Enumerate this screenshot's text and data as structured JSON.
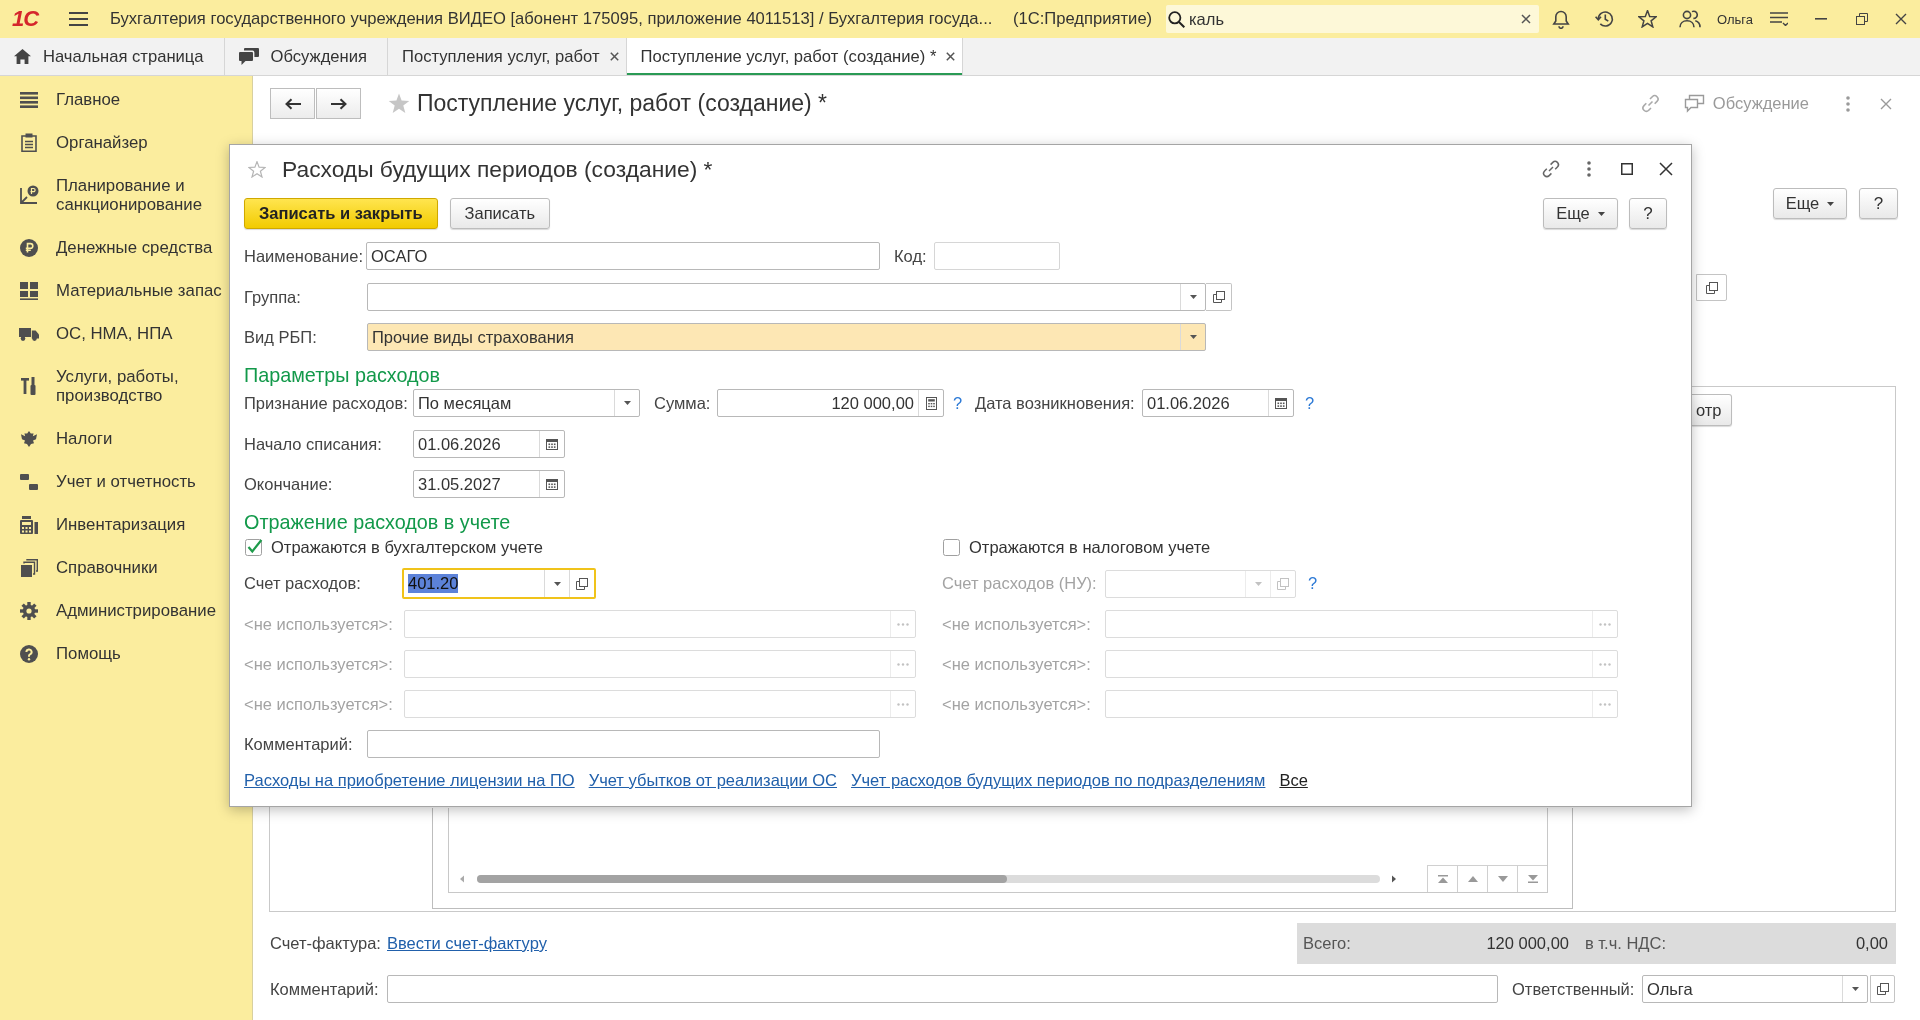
{
  "app_bar": {
    "logo": "1С",
    "title": "Бухгалтерия государственного учреждения ВИДЕО [абонент 175095, приложение 4011513] / Бухгалтерия госуда...",
    "app_name": "(1С:Предприятие)",
    "search": {
      "value": "каль"
    },
    "user": "Ольга"
  },
  "tabs": [
    {
      "label": "Начальная страница",
      "kind": "home",
      "closable": false,
      "selected": false
    },
    {
      "label": "Обсуждения",
      "kind": "chat",
      "closable": false,
      "selected": false
    },
    {
      "label": "Поступления услуг, работ",
      "kind": "document",
      "closable": true,
      "selected": false
    },
    {
      "label": "Поступление услуг, работ (создание) *",
      "kind": "document",
      "closable": true,
      "selected": true
    }
  ],
  "sidebar": {
    "items": [
      {
        "label": "Главное",
        "selected": false
      },
      {
        "label": "Органайзер",
        "selected": false
      },
      {
        "label": "Планирование и санкционирование",
        "selected": false
      },
      {
        "label": "Денежные средства",
        "selected": false
      },
      {
        "label": "Материальные запас",
        "selected": false
      },
      {
        "label": "ОС, НМА, НПА",
        "selected": false
      },
      {
        "label": "Услуги, работы, производство",
        "selected": false
      },
      {
        "label": "Налоги",
        "selected": false
      },
      {
        "label": "Учет и отчетность",
        "selected": false
      },
      {
        "label": "Инвентаризация",
        "selected": false
      },
      {
        "label": "Справочники",
        "selected": false
      },
      {
        "label": "Администрирование",
        "selected": false
      },
      {
        "label": "Помощь",
        "selected": false
      }
    ]
  },
  "document": {
    "title": "Поступление услуг, работ (создание) *",
    "discussion": "Обсуждение",
    "more_button": "Еще",
    "help_button": "?",
    "view_button": "отр",
    "invoice": {
      "label": "Счет-фактура:",
      "link": "Ввести счет-фактуру"
    },
    "totals": {
      "total_label": "Всего:",
      "total": "120 000,00",
      "vat_label": "в т.ч. НДС:",
      "vat": "0,00"
    },
    "comment": {
      "label": "Комментарий:"
    },
    "responsible": {
      "label": "Ответственный:",
      "value": "Ольга"
    }
  },
  "dialog": {
    "title": "Расходы будущих периодов (создание) *",
    "buttons": [
      {
        "label": "Записать и закрыть",
        "kind": "primary"
      },
      {
        "label": "Записать",
        "kind": "default"
      }
    ],
    "more_button": "Еще",
    "help_button": "?",
    "name": {
      "label": "Наименование:",
      "value": "ОСАГО"
    },
    "code": {
      "label": "Код:"
    },
    "group": {
      "label": "Группа:"
    },
    "expense_type": {
      "label": "Вид РБП:",
      "value": "Прочие виды страхования"
    },
    "parameters": {
      "heading": "Параметры расходов",
      "recognition": {
        "label": "Признание расходов:",
        "value": "По месяцам"
      },
      "amount": {
        "label": "Сумма:",
        "value": "120 000,00",
        "help": "?"
      },
      "origin_date": {
        "label": "Дата возникновения:",
        "value": "01.06.2026",
        "help": "?"
      },
      "start_date": {
        "label": "Начало списания:",
        "value": "01.06.2026"
      },
      "end_date": {
        "label": "Окончание:",
        "value": "31.05.2027"
      }
    },
    "accounting": {
      "heading": "Отражение расходов в учете",
      "columns": [
        {
          "checkbox": {
            "label": "Отражаются в бухгалтерском учете",
            "checked": true
          },
          "account": {
            "label": "Счет расходов:",
            "value": "401.20",
            "disabled": false,
            "focused": true,
            "text_selected": true
          },
          "analytics": [
            {
              "label": "<не используется>:",
              "disabled": true
            },
            {
              "label": "<не используется>:",
              "disabled": true
            },
            {
              "label": "<не используется>:",
              "disabled": true
            }
          ]
        },
        {
          "checkbox": {
            "label": "Отражаются в налоговом учете",
            "checked": false
          },
          "account": {
            "label": "Счет расходов (НУ):",
            "disabled": true,
            "focused": false,
            "help": "?"
          },
          "analytics": [
            {
              "label": "<не используется>:",
              "disabled": true
            },
            {
              "label": "<не используется>:",
              "disabled": true
            },
            {
              "label": "<не используется>:",
              "disabled": true
            }
          ]
        }
      ]
    },
    "comment": {
      "label": "Комментарий:"
    },
    "links": [
      {
        "label": "Расходы на приобретение лицензии на ПО",
        "kind": "link"
      },
      {
        "label": "Учет убытков от реализации ОС",
        "kind": "link"
      },
      {
        "label": "Учет расходов будущих периодов по подразделениям",
        "kind": "link"
      },
      {
        "label": "Все",
        "kind": "all"
      }
    ]
  }
}
